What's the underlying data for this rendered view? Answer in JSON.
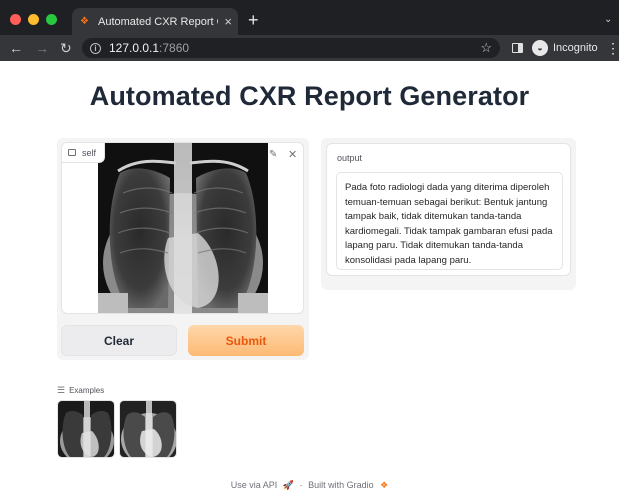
{
  "browser": {
    "tab_title": "Automated CXR Report Genera",
    "url_host": "127.0.0.1",
    "url_port": ":7860",
    "incognito_label": "Incognito",
    "colors": {
      "dot_red": "#ff5f57",
      "dot_yellow": "#febc2e",
      "dot_green": "#28c840"
    }
  },
  "app": {
    "title": "Automated CXR Report Generator",
    "image_input": {
      "label": "self"
    },
    "buttons": {
      "clear": "Clear",
      "submit": "Submit"
    },
    "output": {
      "label": "output",
      "text": "Pada foto radiologi dada yang diterima diperoleh temuan-temuan sebagai berikut: Bentuk jantung tampak baik, tidak ditemukan tanda-tanda kardiomegali. Tidak tampak gambaran efusi pada lapang paru. Tidak ditemukan tanda-tanda konsolidasi pada lapang paru."
    },
    "examples": {
      "label": "Examples",
      "count": 2
    },
    "footer": {
      "api": "Use via API",
      "separator": "·",
      "built": "Built with Gradio"
    },
    "accent_color": "#f97316"
  }
}
